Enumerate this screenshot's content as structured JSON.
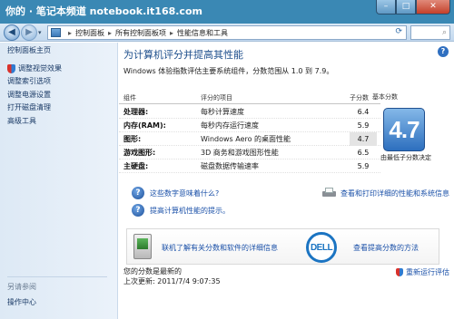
{
  "watermark": "你的 · 笔记本频道 notebook.it168.com",
  "window_controls": {
    "minimize": "–",
    "maximize": "□",
    "close": "✕"
  },
  "address": {
    "back": "◀",
    "forward": "▶",
    "dropdown": "▾",
    "breadcrumbs": [
      "控制面板",
      "所有控制面板项",
      "性能信息和工具"
    ],
    "separator": "▸",
    "refresh": "⟳",
    "search_icon": "⌕"
  },
  "sidebar": {
    "home": "控制面板主页",
    "items": [
      "调整视觉效果",
      "调整索引选项",
      "调整电源设置",
      "打开磁盘清理",
      "高级工具"
    ],
    "see_also": "另请参阅",
    "action_center": "操作中心"
  },
  "main": {
    "help": "?",
    "title": "为计算机评分并提高其性能",
    "subtitle": "Windows 体验指数评估主要系统组件，分数范围从 1.0 到 7.9。",
    "headers": {
      "component": "组件",
      "rated": "评分的项目",
      "subscore": "子分数",
      "base": "基本分数"
    },
    "rows": [
      {
        "component": "处理器:",
        "item": "每秒计算速度",
        "score": "6.4"
      },
      {
        "component": "内存(RAM):",
        "item": "每秒内存运行速度",
        "score": "5.9"
      },
      {
        "component": "图形:",
        "item": "Windows Aero 的桌面性能",
        "score": "4.7"
      },
      {
        "component": "游戏图形:",
        "item": "3D 商务和游戏图形性能",
        "score": "6.5"
      },
      {
        "component": "主硬盘:",
        "item": "磁盘数据传输速率",
        "score": "5.9"
      }
    ],
    "base_score": "4.7",
    "base_note": "由最低子分数决定",
    "link_meaning": "这些数字意味着什么?",
    "link_print": "查看和打印详细的性能和系统信息",
    "link_improve": "提高计算机性能的提示。",
    "promo_link": "联机了解有关分数和软件的详细信息",
    "dell": "DELL",
    "promo_link2": "查看提高分数的方法",
    "status_latest": "您的分数是最新的",
    "status_updated": "上次更新: 2011/7/4 9:07:35",
    "rerun": "重新运行评估"
  }
}
